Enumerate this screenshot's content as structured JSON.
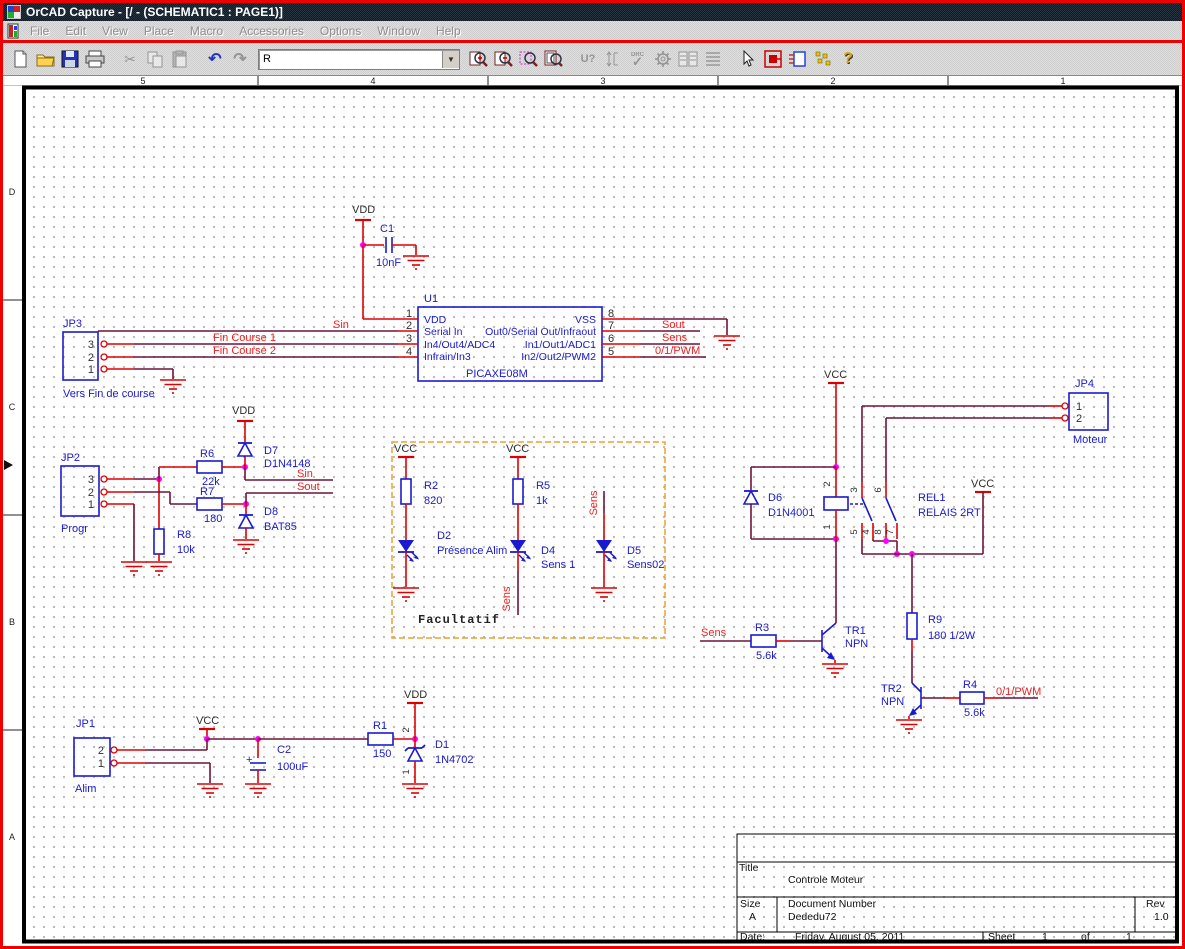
{
  "window": {
    "title": "OrCAD Capture - [/ - (SCHEMATIC1 : PAGE1)]"
  },
  "menu": {
    "items": [
      "File",
      "Edit",
      "View",
      "Place",
      "Macro",
      "Accessories",
      "Options",
      "Window",
      "Help"
    ]
  },
  "toolbar": {
    "combo_value": "R",
    "annotate_glyph": "U?",
    "drc_glyph": "DRC",
    "check_glyph": "✓",
    "cut_glyph": "✂",
    "undo_glyph": "↶",
    "redo_glyph": "↷",
    "help_glyph": "?"
  },
  "rulers": {
    "top": [
      "5",
      "4",
      "3",
      "2",
      "1"
    ],
    "left": [
      "D",
      "C",
      "B",
      "A"
    ]
  },
  "sch": {
    "power": {
      "vdd": "VDD",
      "vcc": "VCC"
    },
    "nets": {
      "sin": "Sin",
      "sout": "Sout",
      "sens": "Sens",
      "pwm": "0/1/PWM",
      "fin1": "Fin Course 1",
      "fin2": "Fin Course 2"
    },
    "c1": {
      "ref": "C1",
      "val": "10nF"
    },
    "c2": {
      "ref": "C2",
      "val": "100uF",
      "plus": "+"
    },
    "u1": {
      "ref": "U1",
      "val": "PICAXE08M",
      "lp": [
        {
          "n": "1",
          "nm": "VDD"
        },
        {
          "n": "2",
          "nm": "Serial In"
        },
        {
          "n": "3",
          "nm": "In4/Out4/ADC4"
        },
        {
          "n": "4",
          "nm": "Infrain/In3"
        }
      ],
      "rp": [
        {
          "n": "8",
          "nm": "VSS"
        },
        {
          "n": "7",
          "nm": "Out0/Serial Out/Infraout"
        },
        {
          "n": "6",
          "nm": "In1/Out1/ADC1"
        },
        {
          "n": "5",
          "nm": "In2/Out2/PWM2"
        }
      ]
    },
    "jp1": {
      "ref": "JP1",
      "cap": "Alim",
      "p": [
        "2",
        "1"
      ]
    },
    "jp2": {
      "ref": "JP2",
      "cap": "Progr",
      "p": [
        "3",
        "2",
        "1"
      ]
    },
    "jp3": {
      "ref": "JP3",
      "cap": "Vers Fin de course",
      "p": [
        "3",
        "2",
        "1"
      ]
    },
    "jp4": {
      "ref": "JP4",
      "cap": "Moteur",
      "p": [
        "1",
        "2"
      ]
    },
    "r1": {
      "ref": "R1",
      "val": "150"
    },
    "r2": {
      "ref": "R2",
      "val": "820"
    },
    "r3": {
      "ref": "R3",
      "val": "5.6k"
    },
    "r4": {
      "ref": "R4",
      "val": "5.6k"
    },
    "r5": {
      "ref": "R5",
      "val": "1k"
    },
    "r6": {
      "ref": "R6",
      "val": "22k"
    },
    "r7": {
      "ref": "R7",
      "val": "180"
    },
    "r8": {
      "ref": "R8",
      "val": "10k"
    },
    "r9": {
      "ref": "R9",
      "val": "180  1/2W"
    },
    "d1": {
      "ref": "D1",
      "val": "1N4702",
      "p": [
        "2",
        "1"
      ]
    },
    "d2": {
      "ref": "D2",
      "val": "Présence Alim"
    },
    "d4": {
      "ref": "D4",
      "val": "Sens 1"
    },
    "d5": {
      "ref": "D5",
      "val": "Sens02"
    },
    "d6": {
      "ref": "D6",
      "val": "D1N4001"
    },
    "d7": {
      "ref": "D7",
      "val": "D1N4148"
    },
    "d8": {
      "ref": "D8",
      "val": "BAT85"
    },
    "tr1": {
      "ref": "TR1",
      "val": "NPN"
    },
    "tr2": {
      "ref": "TR2",
      "val": "NPN"
    },
    "rel1": {
      "ref": "REL1",
      "val": "RELAIS 2RT",
      "coil": [
        "2",
        "1"
      ],
      "cont": [
        "3",
        "5",
        "4",
        "6",
        "8",
        "7"
      ]
    },
    "optional": "Facultatif",
    "tb": {
      "title_l": "Title",
      "title": "Controle Moteur",
      "size_l": "Size",
      "size": "A",
      "doc_l": "Document Number",
      "doc": "Dededu72",
      "rev_l": "Rev",
      "rev": "1.0",
      "date_l": "Date:",
      "date": "Friday, August 05, 2011",
      "sheet_l": "Sheet",
      "sheet": "1",
      "of": "of",
      "total": "1"
    }
  }
}
